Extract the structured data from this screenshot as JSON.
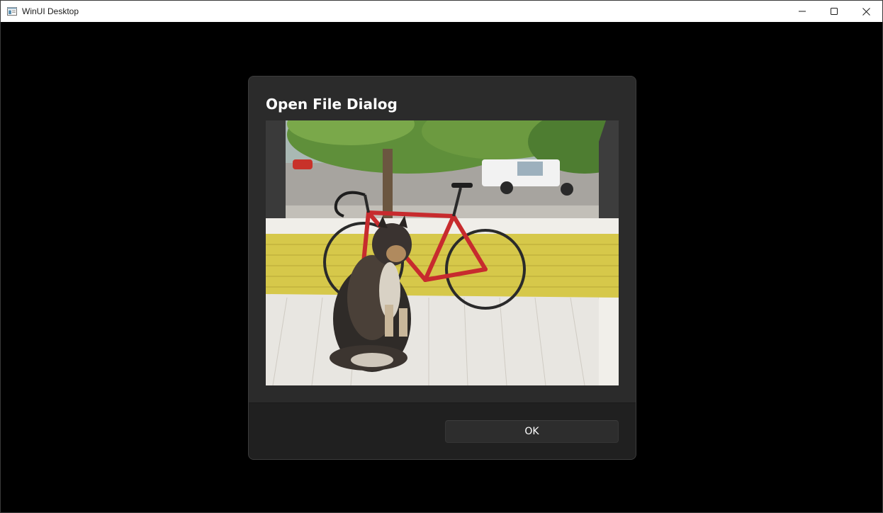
{
  "window": {
    "title": "WinUI Desktop",
    "app_icon": "app-window-icon",
    "controls": {
      "minimize_icon": "minimize-icon",
      "maximize_icon": "maximize-icon",
      "close_icon": "close-icon"
    }
  },
  "dialog": {
    "title": "Open File Dialog",
    "image_subject": "photo",
    "ok_label": "OK"
  },
  "colors": {
    "page_background": "#000000",
    "titlebar_background": "#ffffff",
    "dialog_background": "#2b2b2b",
    "dialog_footer": "#202020",
    "button_background": "#2d2d2d",
    "text": "#ffffff"
  }
}
